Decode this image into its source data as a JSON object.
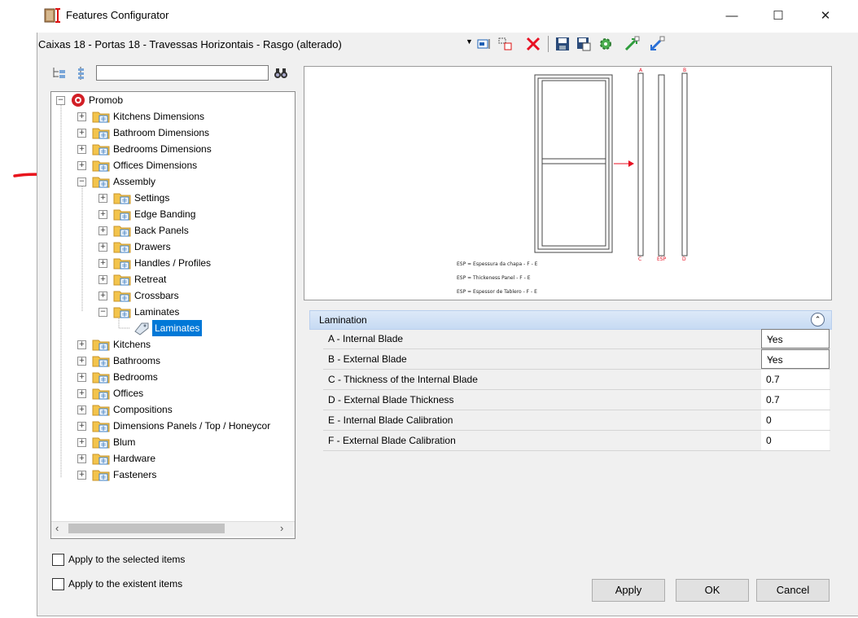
{
  "window": {
    "title": "Features Configurator",
    "minimize": "—",
    "maximize": "☐",
    "close": "✕"
  },
  "toolbar": {
    "profile": "Caixas 18 - Portas 18 - Travessas Horizontais - Rasgo (alterado)"
  },
  "search": {
    "value": "",
    "placeholder": ""
  },
  "tree": {
    "root": "Promob",
    "top_items": [
      "Kitchens Dimensions",
      "Bathroom Dimensions",
      "Bedrooms Dimensions",
      "Offices Dimensions"
    ],
    "assembly": "Assembly",
    "assembly_children": [
      "Settings",
      "Edge Banding",
      "Back Panels",
      "Drawers",
      "Handles / Profiles",
      "Retreat",
      "Crossbars"
    ],
    "laminates": "Laminates",
    "laminates_child": "Laminates",
    "bottom_items": [
      "Kitchens",
      "Bathrooms",
      "Bedrooms",
      "Offices",
      "Compositions",
      "Dimensions Panels / Top / Honeycor",
      "Blum",
      "Hardware",
      "Fasteners"
    ]
  },
  "preview": {
    "label_a": "A",
    "label_b": "B",
    "label_c": "C",
    "label_esp": "ESP",
    "label_d": "D",
    "legend": [
      "ESP = Espessura da chapa - F - E",
      "ESP = Thickeness Panel - F - E",
      "ESP = Espessor de Tablero - F - E"
    ]
  },
  "properties": {
    "section": "Lamination",
    "rows": [
      {
        "label": "A -  Internal Blade",
        "value": "Yes"
      },
      {
        "label": "B - External Blade",
        "value": "Yes"
      },
      {
        "label": "C -  Thickness of the Internal Blade",
        "value": "0.7"
      },
      {
        "label": "D - External Blade Thickness",
        "value": "0.7"
      },
      {
        "label": "E -  Internal Blade Calibration",
        "value": "0"
      },
      {
        "label": "F - External Blade Calibration",
        "value": "0"
      }
    ]
  },
  "options": {
    "apply_selected": "Apply to the selected items",
    "apply_existent": "Apply to the existent items"
  },
  "buttons": {
    "apply": "Apply",
    "ok": "OK",
    "cancel": "Cancel"
  },
  "colors": {
    "selection": "#0078d7",
    "annotation_arrow": "#e8141c",
    "delete_icon": "#e81123",
    "folder": "#f3c44c"
  }
}
